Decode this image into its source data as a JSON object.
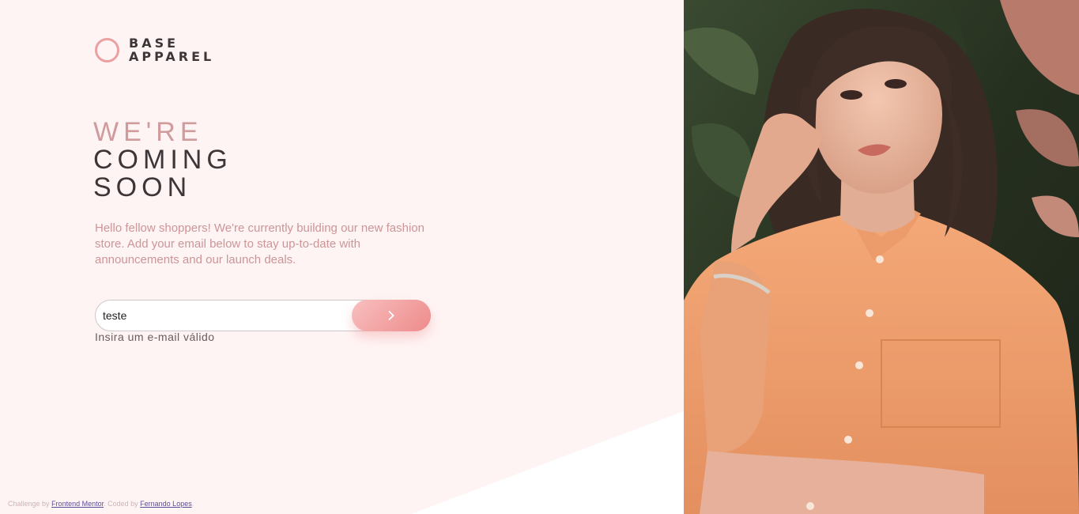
{
  "logo": {
    "line1": "BASE",
    "line2": "APPAREL"
  },
  "headline": {
    "line1": "WE'RE",
    "line2": "COMING",
    "line3": "SOON"
  },
  "description": "Hello fellow shoppers! We're currently building our new fashion store. Add your email below to stay up-to-date with announcements and our launch deals.",
  "form": {
    "email_value": "teste",
    "submit_icon": "chevron-right-icon",
    "error_message": "Insira um e-mail válido"
  },
  "footer": {
    "challenge_prefix": "Challenge by",
    "challenge_link": "Frontend Mentor",
    "coded_prefix": ". Coded by",
    "coded_link": "Fernando Lopes",
    "suffix": "."
  },
  "hero": {
    "image": "woman-in-orange-shirt-photo"
  },
  "colors": {
    "accent": "#e9a1a4",
    "dark_text": "#3d3638",
    "soft_pink_text": "#cc9597",
    "button_gradient_start": "#f8bfbf",
    "button_gradient_end": "#ee8b8b"
  }
}
